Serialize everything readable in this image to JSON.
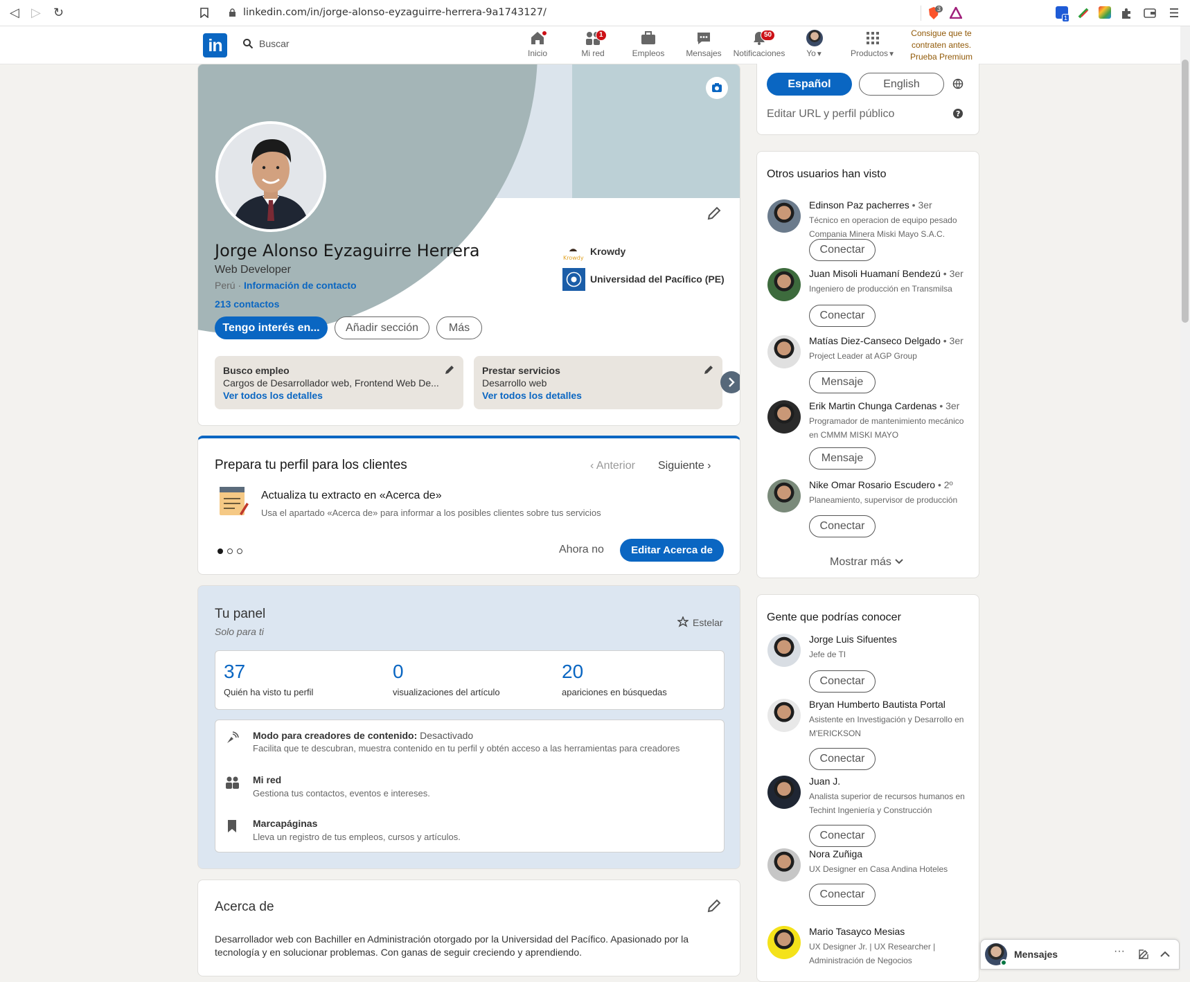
{
  "browser": {
    "url": "linkedin.com/in/jorge-alonso-eyzaguirre-herrera-9a1743127/",
    "ext_badge_1": "3",
    "ext_badge_2": "1"
  },
  "header": {
    "search_placeholder": "Buscar",
    "nav": [
      {
        "label": "Inicio",
        "badge": ""
      },
      {
        "label": "Mi red",
        "badge": "1"
      },
      {
        "label": "Empleos",
        "badge": ""
      },
      {
        "label": "Mensajes",
        "badge": ""
      },
      {
        "label": "Notificaciones",
        "badge": "50"
      },
      {
        "label": "Yo",
        "badge": ""
      },
      {
        "label": "Productos",
        "badge": ""
      }
    ],
    "premium_line1": "Consigue que te",
    "premium_line2": "contraten antes.",
    "premium_line3": "Prueba Premium gratis."
  },
  "profile": {
    "name": "Jorge Alonso Eyzaguirre Herrera",
    "headline": "Web Developer",
    "location": "Perú ·",
    "contact_link": "Información de contacto",
    "connections": "213 contactos",
    "company": "Krowdy",
    "school": "Universidad del Pacífico (PE)",
    "btn_interest": "Tengo interés en...",
    "btn_add_section": "Añadir sección",
    "btn_more": "Más",
    "card1_title": "Busco empleo",
    "card1_desc": "Cargos de Desarrollador web, Frontend Web De...",
    "card1_link": "Ver todos los detalles",
    "card2_title": "Prestar servicios",
    "card2_desc": "Desarrollo web",
    "card2_link": "Ver todos los detalles"
  },
  "prepare": {
    "title": "Prepara tu perfil para los clientes",
    "prev": "Anterior",
    "next": "Siguiente",
    "item_title": "Actualiza tu extracto en «Acerca de»",
    "item_desc": "Usa el apartado «Acerca de» para informar a los posibles clientes sobre tus servicios",
    "btn_later": "Ahora no",
    "btn_edit": "Editar Acerca de"
  },
  "panel": {
    "title": "Tu panel",
    "subtitle": "Solo para ti",
    "star": "Estelar",
    "stats": [
      {
        "value": "37",
        "label": "Quién ha visto tu perfil"
      },
      {
        "value": "0",
        "label": "visualizaciones del artículo"
      },
      {
        "value": "20",
        "label": "apariciones en búsquedas"
      }
    ],
    "creator_title": "Modo para creadores de contenido:",
    "creator_status": "Desactivado",
    "creator_desc": "Facilita que te descubran, muestra contenido en tu perfil y obtén acceso a las herramientas para creadores",
    "network_title": "Mi red",
    "network_desc": "Gestiona tus contactos, eventos e intereses.",
    "bookmarks_title": "Marcapáginas",
    "bookmarks_desc": "Lleva un registro de tus empleos, cursos y artículos."
  },
  "about": {
    "title": "Acerca de",
    "text_line1": "Desarrollador web con Bachiller en Administración otorgado por la Universidad del Pacífico. Apasionado por la",
    "text_line2": "tecnología y en solucionar problemas. Con ganas de seguir creciendo y aprendiendo."
  },
  "sidebar": {
    "lang_es": "Español",
    "lang_en": "English",
    "edit_url": "Editar URL y perfil público",
    "others_title": "Otros usuarios han visto",
    "others": [
      {
        "name": "Edinson Paz pacherres",
        "deg": "• 3er",
        "h1": "Técnico en operacion de equipo pesado",
        "h2": "Compania Minera Miski Mayo S.A.C.",
        "btn": "Conectar"
      },
      {
        "name": "Juan Misoli Huamaní Bendezú",
        "deg": "• 3er",
        "h1": "Ingeniero de producción en Transmilsa",
        "h2": "",
        "btn": "Conectar"
      },
      {
        "name": "Matías Diez-Canseco Delgado",
        "deg": "• 3er",
        "h1": "Project Leader at AGP Group",
        "h2": "",
        "btn": "Mensaje"
      },
      {
        "name": "Erik Martin Chunga Cardenas",
        "deg": "• 3er",
        "h1": "Programador de mantenimiento mecánico",
        "h2": "en CMMM MISKI MAYO",
        "btn": "Mensaje"
      },
      {
        "name": "Nike Omar Rosario Escudero",
        "deg": "• 2º",
        "h1": "Planeamiento, supervisor de producción",
        "h2": "",
        "btn": "Conectar"
      }
    ],
    "show_more": "Mostrar más",
    "people_title": "Gente que podrías conocer",
    "people": [
      {
        "name": "Jorge Luis Sifuentes",
        "h1": "Jefe de TI",
        "h2": "",
        "btn": "Conectar"
      },
      {
        "name": "Bryan Humberto Bautista Portal",
        "h1": "Asistente en Investigación y Desarrollo en",
        "h2": "M'ERICKSON",
        "btn": "Conectar"
      },
      {
        "name": "Juan J.",
        "h1": "Analista superior de recursos humanos en",
        "h2": "Techint Ingeniería y Construcción",
        "btn": "Conectar"
      },
      {
        "name": "Nora Zuñiga",
        "h1": "UX Designer en Casa Andina Hoteles",
        "h2": "",
        "btn": "Conectar"
      },
      {
        "name": "Mario Tasayco Mesias",
        "h1": "UX Designer Jr. | UX Researcher |",
        "h2": "Administración de Negocios",
        "btn": ""
      }
    ],
    "messaging": "Mensajes"
  },
  "colors": {
    "brand": "#0a66c2",
    "badge": "#cc1016",
    "premium": "#915907"
  }
}
